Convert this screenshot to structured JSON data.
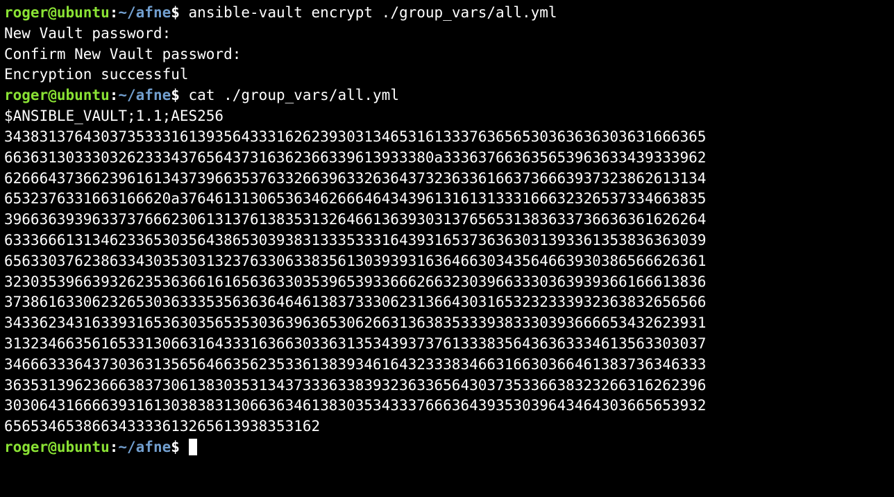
{
  "prompt": {
    "user_host": "roger@ubuntu",
    "colon": ":",
    "path": "~/afne",
    "dollar": "$"
  },
  "lines": [
    {
      "type": "prompt_cmd",
      "command": "ansible-vault encrypt ./group_vars/all.yml"
    },
    {
      "type": "out",
      "text": "New Vault password:"
    },
    {
      "type": "out",
      "text": "Confirm New Vault password:"
    },
    {
      "type": "out",
      "text": "Encryption successful"
    },
    {
      "type": "prompt_cmd",
      "command": "cat ./group_vars/all.yml"
    },
    {
      "type": "out",
      "text": "$ANSIBLE_VAULT;1.1;AES256"
    },
    {
      "type": "out",
      "text": "34383137643037353331613935643331626239303134653161333763656530363636303631666365"
    },
    {
      "type": "out",
      "text": "6636313033303262333437656437316362366339613933380a333637663635653963633439333962"
    },
    {
      "type": "out",
      "text": "62666437366239616134373966353763326639633263643732363361663736663937323862613134"
    },
    {
      "type": "out",
      "text": "6532376331663166620a376461313065363462666464343961316131333166632326537334663835"
    },
    {
      "type": "out",
      "text": "39663639396337376662306131376138353132646613639303137656531383633736636361626264"
    },
    {
      "type": "out",
      "text": "63336661313462336530356438653039383133353331643931653736363031393361353836363039"
    },
    {
      "type": "out",
      "text": "65633037623863343035303132376330633835613039393163646630343564663930386566626361"
    },
    {
      "type": "out",
      "text": "32303539663932623536366161656363303539653933666266323039663330363939366166613836"
    },
    {
      "type": "out",
      "text": "37386163306232653036333535636364646138373330623136643031653232333932363832656566"
    },
    {
      "type": "out",
      "text": "34336234316339316536303565353036396365306266313638353339383330393666653432623931"
    },
    {
      "type": "out",
      "text": "31323466356165331306631643331636630336313534393737613338356436363334613563303037"
    },
    {
      "type": "out",
      "text": "34666333643730363135656466356235336138393461643233383466316630366461383736346333"
    },
    {
      "type": "out",
      "text": "36353139623666383730613830353134373336338393236336564303735336638323266316262396"
    },
    {
      "type": "out",
      "text": "30306431666639316130383831306636346138303534333766636439353039643464303665653932"
    },
    {
      "type": "out",
      "text": "656534653866343333613265613938353162"
    },
    {
      "type": "prompt_cursor"
    }
  ]
}
